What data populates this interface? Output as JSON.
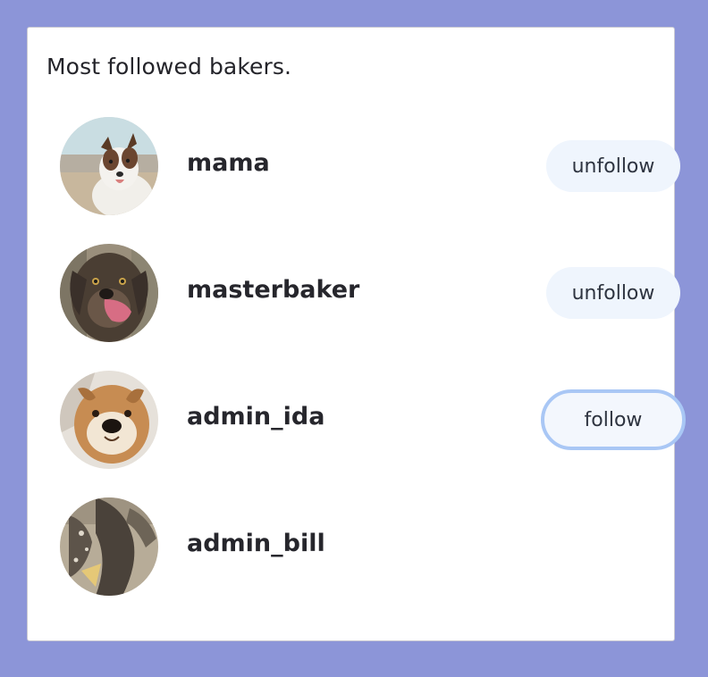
{
  "card": {
    "title": "Most followed bakers."
  },
  "bakers": [
    {
      "username": "mama",
      "button_label": "unfollow"
    },
    {
      "username": "masterbaker",
      "button_label": "unfollow"
    },
    {
      "username": "admin_ida",
      "button_label": "follow"
    },
    {
      "username": "admin_bill"
    }
  ],
  "colors": {
    "page_background": "#8c95d8",
    "card_background": "#ffffff",
    "button_background": "#eff5fd",
    "focus_ring": "#a9c7f5"
  }
}
